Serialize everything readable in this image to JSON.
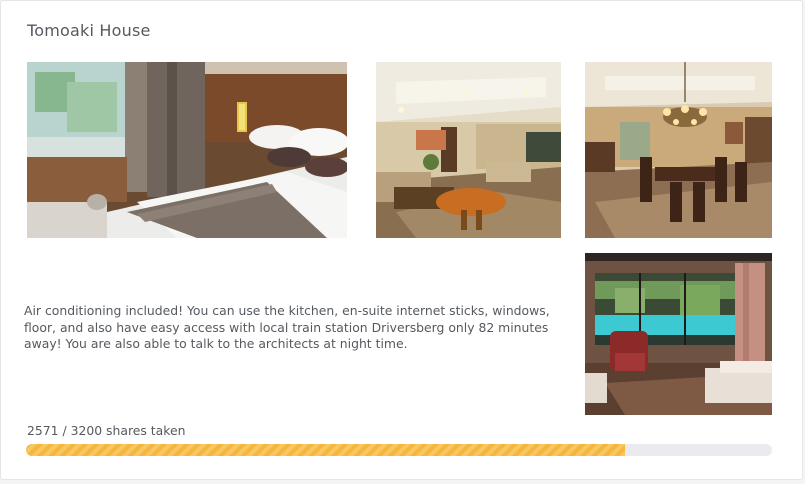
{
  "listing": {
    "title": "Tomoaki House",
    "description": "Air conditioning included! You can use the kitchen, en-suite internet sticks, windows, floor, and also have easy access with local train station Driversberg only 82 minutes away! You are also able to talk to the architects at night time."
  },
  "photos": [
    {
      "subject": "bedroom"
    },
    {
      "subject": "living-room"
    },
    {
      "subject": "dining-room"
    },
    {
      "subject": "lounge"
    }
  ],
  "shares": {
    "taken": 2571,
    "total": 3200,
    "label": "2571 / 3200 shares taken",
    "fill_color": "#f5b63a",
    "track_color": "#e9ebee"
  }
}
